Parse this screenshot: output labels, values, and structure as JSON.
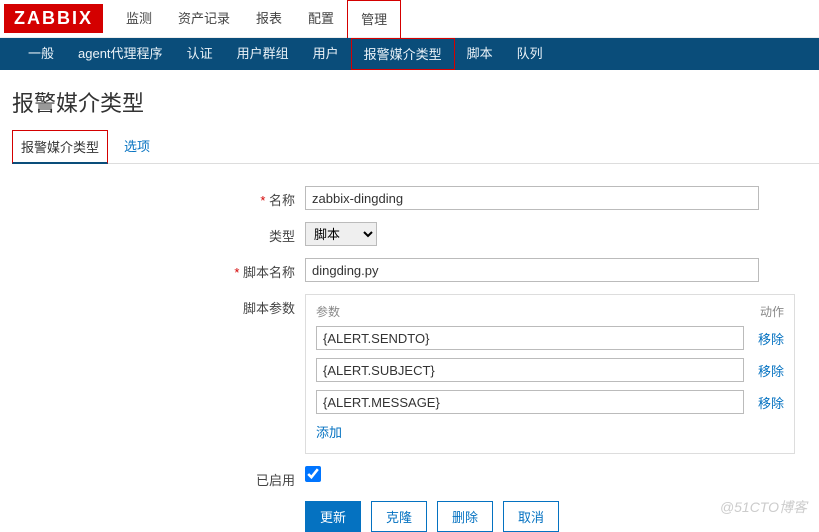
{
  "logo": "ZABBIX",
  "topnav": {
    "items": [
      {
        "label": "监测"
      },
      {
        "label": "资产记录"
      },
      {
        "label": "报表"
      },
      {
        "label": "配置"
      },
      {
        "label": "管理",
        "active": true
      }
    ]
  },
  "subnav": {
    "items": [
      {
        "label": "一般"
      },
      {
        "label": "agent代理程序"
      },
      {
        "label": "认证"
      },
      {
        "label": "用户群组"
      },
      {
        "label": "用户"
      },
      {
        "label": "报警媒介类型",
        "active": true
      },
      {
        "label": "脚本"
      },
      {
        "label": "队列"
      }
    ]
  },
  "page_title": "报警媒介类型",
  "tabs": {
    "items": [
      {
        "label": "报警媒介类型",
        "active": true
      },
      {
        "label": "选项"
      }
    ]
  },
  "form": {
    "name_label": "名称",
    "name_value": "zabbix-dingding",
    "type_label": "类型",
    "type_value": "脚本",
    "script_name_label": "脚本名称",
    "script_name_value": "dingding.py",
    "script_params_label": "脚本参数",
    "params_header_name": "参数",
    "params_header_action": "动作",
    "params": [
      {
        "value": "{ALERT.SENDTO}"
      },
      {
        "value": "{ALERT.SUBJECT}"
      },
      {
        "value": "{ALERT.MESSAGE}"
      }
    ],
    "remove_label": "移除",
    "add_label": "添加",
    "enabled_label": "已启用",
    "enabled_checked": true
  },
  "buttons": {
    "update": "更新",
    "clone": "克隆",
    "delete": "删除",
    "cancel": "取消"
  },
  "watermark": "@51CTO博客"
}
